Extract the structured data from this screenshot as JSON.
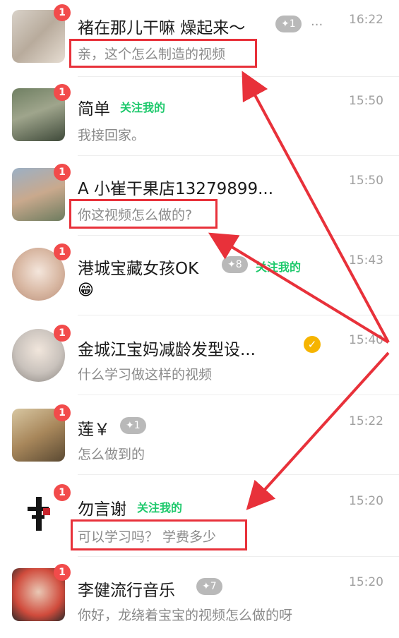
{
  "chats": [
    {
      "name": "褚在那儿干嘛 燥起来～",
      "level": "✦1",
      "extra": "...",
      "preview": "亲，这个怎么制造的视频",
      "time": "16:22",
      "badge": "1"
    },
    {
      "name": "简单",
      "tag": "关注我的",
      "preview": "我接回家。",
      "time": "15:50",
      "badge": "1"
    },
    {
      "name": "A 小崔干果店13279899...",
      "preview": "你这视频怎么做的?",
      "time": "15:50",
      "badge": "1"
    },
    {
      "name": "港城宝藏女孩OK",
      "level": "✦8",
      "tag": "关注我的",
      "preview": "😁",
      "time": "15:43",
      "badge": "1"
    },
    {
      "name": "金城江宝妈减龄发型设...",
      "verified": "✓",
      "preview": "什么学习做这样的视频",
      "time": "15:40",
      "badge": "1"
    },
    {
      "name": "莲￥",
      "level": "✦1",
      "preview": "怎么做到的",
      "time": "15:22",
      "badge": "1"
    },
    {
      "name": "勿言谢",
      "tag": "关注我的",
      "preview": "可以学习吗？ 学费多少",
      "time": "15:20",
      "badge": "1"
    },
    {
      "name": "李健流行音乐",
      "level": "✦7",
      "preview": "你好，龙绕着宝宝的视频怎么做的呀",
      "time": "15:20",
      "badge": "1"
    }
  ],
  "colors": {
    "accent_green": "#1ec96c",
    "badge_red": "#f24b4b",
    "highlight_red": "#e8313a"
  }
}
